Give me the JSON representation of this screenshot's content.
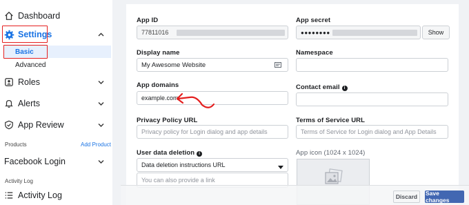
{
  "sidebar": {
    "items": [
      {
        "label": "Dashboard"
      },
      {
        "label": "Settings"
      },
      {
        "label": "Roles"
      },
      {
        "label": "Alerts"
      },
      {
        "label": "App Review"
      },
      {
        "label": "Facebook Login"
      },
      {
        "label": "Activity Log"
      }
    ],
    "sub_items": [
      {
        "label": "Basic"
      },
      {
        "label": "Advanced"
      }
    ],
    "products_label": "Products",
    "add_product": "Add Product",
    "activity_log_section": "Activity Log"
  },
  "form": {
    "app_id": {
      "label": "App ID",
      "value": "77811016"
    },
    "app_secret": {
      "label": "App secret",
      "value": "●●●●●●●●",
      "show_label": "Show"
    },
    "display_name": {
      "label": "Display name",
      "value": "My Awesome Website"
    },
    "namespace": {
      "label": "Namespace",
      "value": ""
    },
    "app_domains": {
      "label": "App domains",
      "value": "example.com"
    },
    "contact_email": {
      "label": "Contact email",
      "value": ""
    },
    "privacy_policy": {
      "label": "Privacy Policy URL",
      "placeholder": "Privacy policy for Login dialog and app details"
    },
    "terms_of_service": {
      "label": "Terms of Service URL",
      "placeholder": "Terms of Service for Login dialog and App Details"
    },
    "user_data_deletion": {
      "label": "User data deletion",
      "select_value": "Data deletion instructions URL",
      "placeholder": "You can also provide a link"
    },
    "app_icon": {
      "label": "App icon (1024 x 1024)"
    }
  },
  "footer": {
    "discard": "Discard",
    "save": "Save changes"
  },
  "colors": {
    "accent": "#1b74e4",
    "highlight": "#e41e1e",
    "save_button": "#4267b2"
  }
}
